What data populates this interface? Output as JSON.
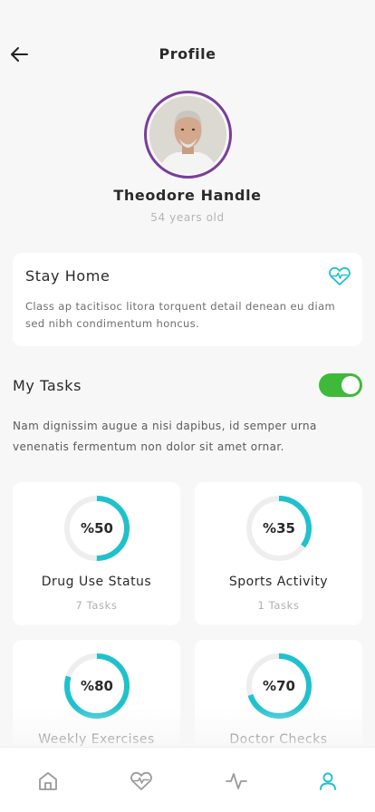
{
  "header": {
    "title": "Profile"
  },
  "profile": {
    "name": "Theodore Handle",
    "age": "54 years old"
  },
  "stay_home": {
    "title": "Stay Home",
    "text": "Class ap tacitisoc litora torquent detail denean eu diam sed nibh condimentum honcus."
  },
  "tasks": {
    "title": "My Tasks",
    "toggle_on": true,
    "description": "Nam dignissim augue a nisi dapibus, id semper urna venenatis fermentum non dolor sit amet ornar."
  },
  "stats": [
    {
      "label": "%50",
      "progress": 0.5,
      "title": "Drug Use Status",
      "sub": "7 Tasks"
    },
    {
      "label": "%35",
      "progress": 0.35,
      "title": "Sports Activity",
      "sub": "1 Tasks"
    },
    {
      "label": "%80",
      "progress": 0.8,
      "title": "Weekly Exercises",
      "sub": ""
    },
    {
      "label": "%70",
      "progress": 0.7,
      "title": "Doctor Checks",
      "sub": ""
    }
  ],
  "colors": {
    "accent": "#1fc1cd",
    "ring_track": "#eeeeee",
    "avatar_border": "#7a3e99",
    "toggle": "#3fb93a",
    "icon_gray": "#9a9a9a"
  },
  "tabbar": {
    "items": [
      {
        "icon": "home-icon",
        "active": false
      },
      {
        "icon": "heart-pulse-icon",
        "active": false
      },
      {
        "icon": "activity-icon",
        "active": false
      },
      {
        "icon": "user-icon",
        "active": true
      }
    ]
  }
}
